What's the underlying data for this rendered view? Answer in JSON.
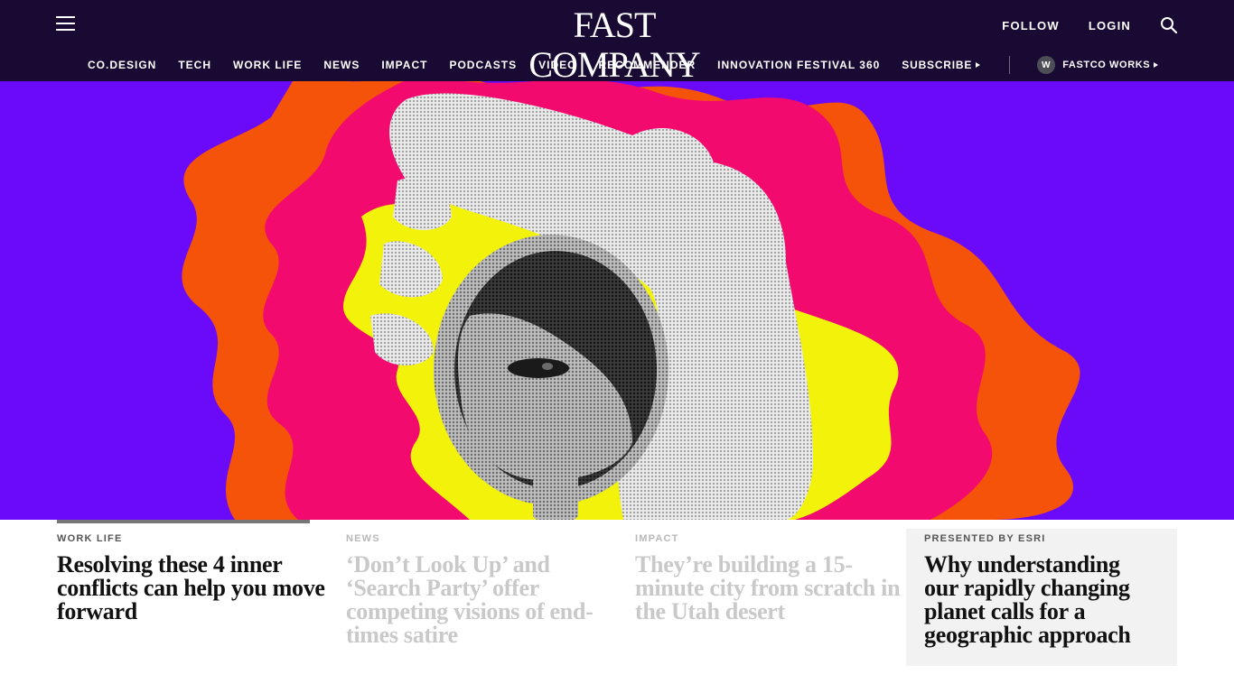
{
  "header": {
    "logo": "FAST COMPANY",
    "follow_label": "FOLLOW",
    "login_label": "LOGIN",
    "icons": {
      "menu": "hamburger-menu-icon",
      "search": "search-icon"
    }
  },
  "nav": {
    "items": [
      {
        "label": "CO.DESIGN"
      },
      {
        "label": "TECH"
      },
      {
        "label": "WORK LIFE"
      },
      {
        "label": "NEWS"
      },
      {
        "label": "IMPACT"
      },
      {
        "label": "PODCASTS"
      },
      {
        "label": "VIDEO"
      },
      {
        "label": "RECOMMENDER"
      },
      {
        "label": "INNOVATION FESTIVAL 360"
      }
    ],
    "subscribe_label": "SUBSCRIBE",
    "fastco_works": {
      "badge": "W",
      "label": "FASTCO WORKS"
    }
  },
  "hero": {
    "image": "halftone-hand-holding-magnifying-glass-over-eye",
    "colors": {
      "background": "#6b0af8",
      "orange": "#f5520a",
      "pink": "#f30a6e",
      "yellow": "#f2f20a"
    }
  },
  "articles": [
    {
      "kicker": "WORK LIFE",
      "headline": "Resolving these 4 inner conflicts can help you move forward",
      "state": "active"
    },
    {
      "kicker": "NEWS",
      "headline": "‘Don’t Look Up’ and ‘Search Party’ offer competing visions of end-times satire",
      "state": "dim"
    },
    {
      "kicker": "IMPACT",
      "headline": "They’re building a 15-minute city from scratch in the Utah desert",
      "state": "dim"
    },
    {
      "kicker": "PRESENTED BY ESRI",
      "headline": "Why understanding our rapidly changing planet calls for a geographic approach",
      "state": "sponsored"
    }
  ],
  "colors": {
    "header_bg": "#180a33",
    "accent": "#6b0af8"
  }
}
